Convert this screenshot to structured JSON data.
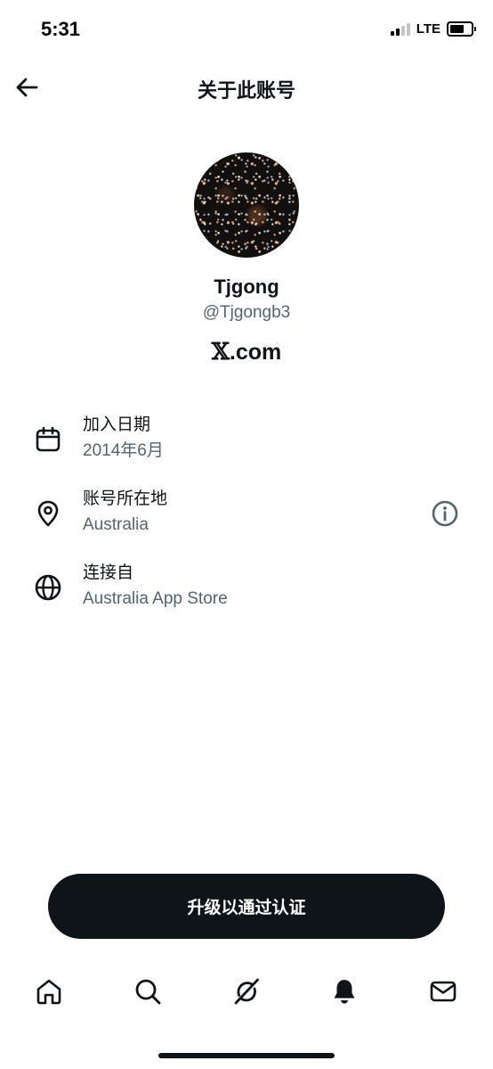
{
  "status_bar": {
    "time": "5:31",
    "network": "LTE",
    "signal_icon": "signal-bars-icon",
    "battery_icon": "battery-icon"
  },
  "header": {
    "title": "关于此账号",
    "back_icon": "arrow-left-icon"
  },
  "profile": {
    "display_name": "Tjgong",
    "handle": "@Tjgongb3",
    "brand_mark": "𝕏",
    "brand_domain": ".com"
  },
  "info_items": [
    {
      "icon": "calendar-icon",
      "label": "加入日期",
      "value": "2014年6月"
    },
    {
      "icon": "location-pin-icon",
      "label": "账号所在地",
      "value": "Australia",
      "action_icon": "info-icon"
    },
    {
      "icon": "globe-icon",
      "label": "连接自",
      "value": "Australia App Store"
    }
  ],
  "upgrade_button": {
    "label": "升级以通过认证"
  },
  "tab_bar": [
    {
      "icon": "home-icon"
    },
    {
      "icon": "search-icon"
    },
    {
      "icon": "grok-icon"
    },
    {
      "icon": "notifications-bell-icon"
    },
    {
      "icon": "messages-envelope-icon"
    }
  ],
  "colors": {
    "text_primary": "#0f1419",
    "text_secondary": "#536471",
    "button_background": "#0f1419",
    "background": "#ffffff"
  }
}
